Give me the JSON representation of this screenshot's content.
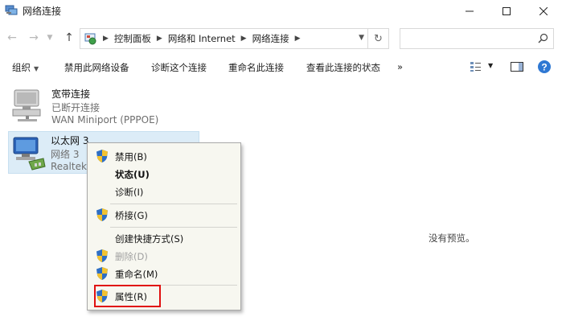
{
  "window": {
    "title": "网络连接",
    "icon": "network-connections-icon"
  },
  "nav": {
    "breadcrumb": [
      "控制面板",
      "网络和 Internet",
      "网络连接"
    ],
    "search_placeholder": ""
  },
  "toolbar": {
    "organize": "组织",
    "disable": "禁用此网络设备",
    "diagnose": "诊断这个连接",
    "rename": "重命名此连接",
    "view_status": "查看此连接的状态",
    "more": "»"
  },
  "connections": [
    {
      "name": "宽带连接",
      "status": "已断开连接",
      "device": "WAN Miniport (PPPOE)"
    },
    {
      "name": "以太网 3",
      "status": "网络 3",
      "device": "Realtek"
    }
  ],
  "preview_text": "没有预览。",
  "context_menu": {
    "items": [
      {
        "label": "禁用(B)",
        "icon": "uac-shield-icon"
      },
      {
        "label": "状态(U)",
        "bold": true
      },
      {
        "label": "诊断(I)"
      },
      {
        "label": "桥接(G)",
        "icon": "uac-shield-icon"
      },
      {
        "label": "创建快捷方式(S)"
      },
      {
        "label": "删除(D)",
        "disabled": true
      },
      {
        "label": "重命名(M)",
        "icon": "uac-shield-icon"
      },
      {
        "label": "属性(R)",
        "icon": "uac-shield-icon",
        "highlighted": true
      }
    ]
  },
  "colors": {
    "selection": "#dcecf7",
    "highlight_box": "#e01010",
    "menu_bg": "#f7f7f0"
  }
}
